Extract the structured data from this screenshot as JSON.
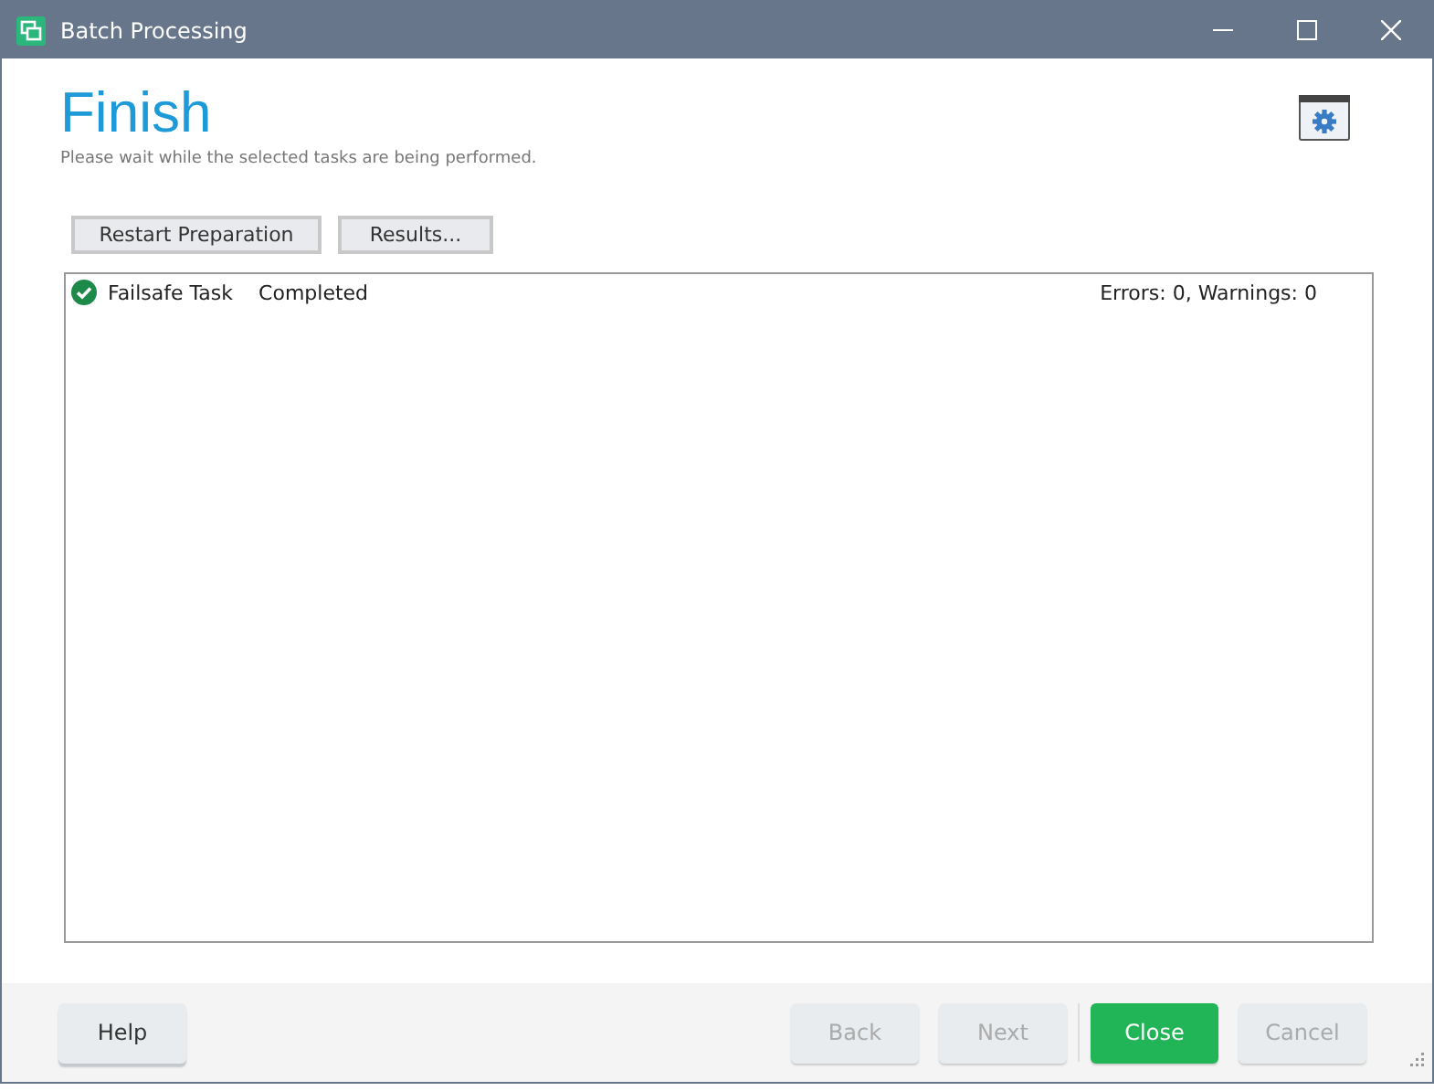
{
  "window": {
    "title": "Batch Processing"
  },
  "header": {
    "title": "Finish",
    "subtitle": "Please wait while the selected tasks are being performed."
  },
  "actions": [
    "Restart Preparation",
    "Results..."
  ],
  "tasks": [
    {
      "name": "Failsafe Task",
      "status": "Completed",
      "kind": "success",
      "summary": "Errors: 0, Warnings: 0"
    }
  ],
  "footer": {
    "help": "Help",
    "buttons": [
      {
        "label": "Back",
        "disabled": true,
        "kind": "normal"
      },
      {
        "label": "Next",
        "disabled": true,
        "kind": "normal"
      },
      {
        "label": "Close",
        "disabled": false,
        "kind": "primary"
      },
      {
        "label": "Cancel",
        "disabled": true,
        "kind": "normal"
      }
    ]
  }
}
